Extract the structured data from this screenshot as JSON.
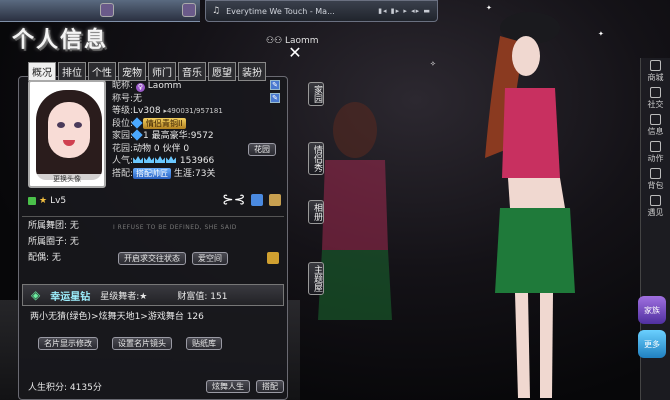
{
  "music_bar": {
    "song": "Everytime We Touch - Ma..."
  },
  "panel": {
    "title": "个人信息",
    "username_header": "Laomm",
    "tabs": [
      "概况",
      "排位",
      "个性",
      "宠物",
      "师门",
      "音乐",
      "愿望",
      "装扮"
    ],
    "active_tab": 0,
    "avatar_caption": "更换头像",
    "nickname_label": "昵称:",
    "nickname": "Laomm",
    "title_label": "称号:",
    "title_value": "无",
    "level_label": "等级:",
    "level": "Lv308",
    "exp": "490031/957181",
    "rank_label": "段位:",
    "rank": "情侣青铜II",
    "home_label": "家园:",
    "home_count": "1",
    "luxury_label": "最高豪华:",
    "luxury": "9572",
    "garden_label": "花园:",
    "garden_pets": "动物 0",
    "garden_partner": "伙伴 0",
    "garden_button": "花园",
    "popularity_label": "人气:",
    "popularity": "153966",
    "match_label": "搭配:",
    "match_value": "搭配帅匠",
    "career_label": "生涯:",
    "career": "73关",
    "lv_badge": "Lv5",
    "dance_group_label": "所属舞团:",
    "dance_group": "无",
    "circle_label": "所属圈子:",
    "circle": "无",
    "spouse_label": "配偶:",
    "spouse": "无",
    "open_relation_btn": "开启求交往状态",
    "love_space_btn": "爱空间",
    "lucky_star": "幸运星钻",
    "star_dancer_label": "星级舞者:",
    "star_dancer": "★",
    "wealth_label": "财富值:",
    "wealth": "151",
    "dance_stat": "两小无猜(绿色)>炫舞天地1>游戏舞台  126",
    "card_edit_btn": "名片显示修改",
    "card_camera_btn": "设置名片镜头",
    "sticker_btn": "贴纸库",
    "life_score_label": "人生积分:",
    "life_score": "4135分",
    "dance_life_btn": "炫舞人生",
    "grid_btn": "搭配",
    "sign": "I REFUSE TO BE DEFINED, SHE SAID"
  },
  "vertical_tabs": [
    "家园",
    "情侣秀",
    "相册",
    "主题屋"
  ],
  "sidebar": [
    "商城",
    "社交",
    "信息",
    "动作",
    "背包",
    "遇见"
  ],
  "sidebar_specials": [
    "家族",
    "更多"
  ],
  "colors": {
    "accent": "#6ac8ff",
    "panel_bg": "#18181c",
    "gold": "#f4d060"
  }
}
